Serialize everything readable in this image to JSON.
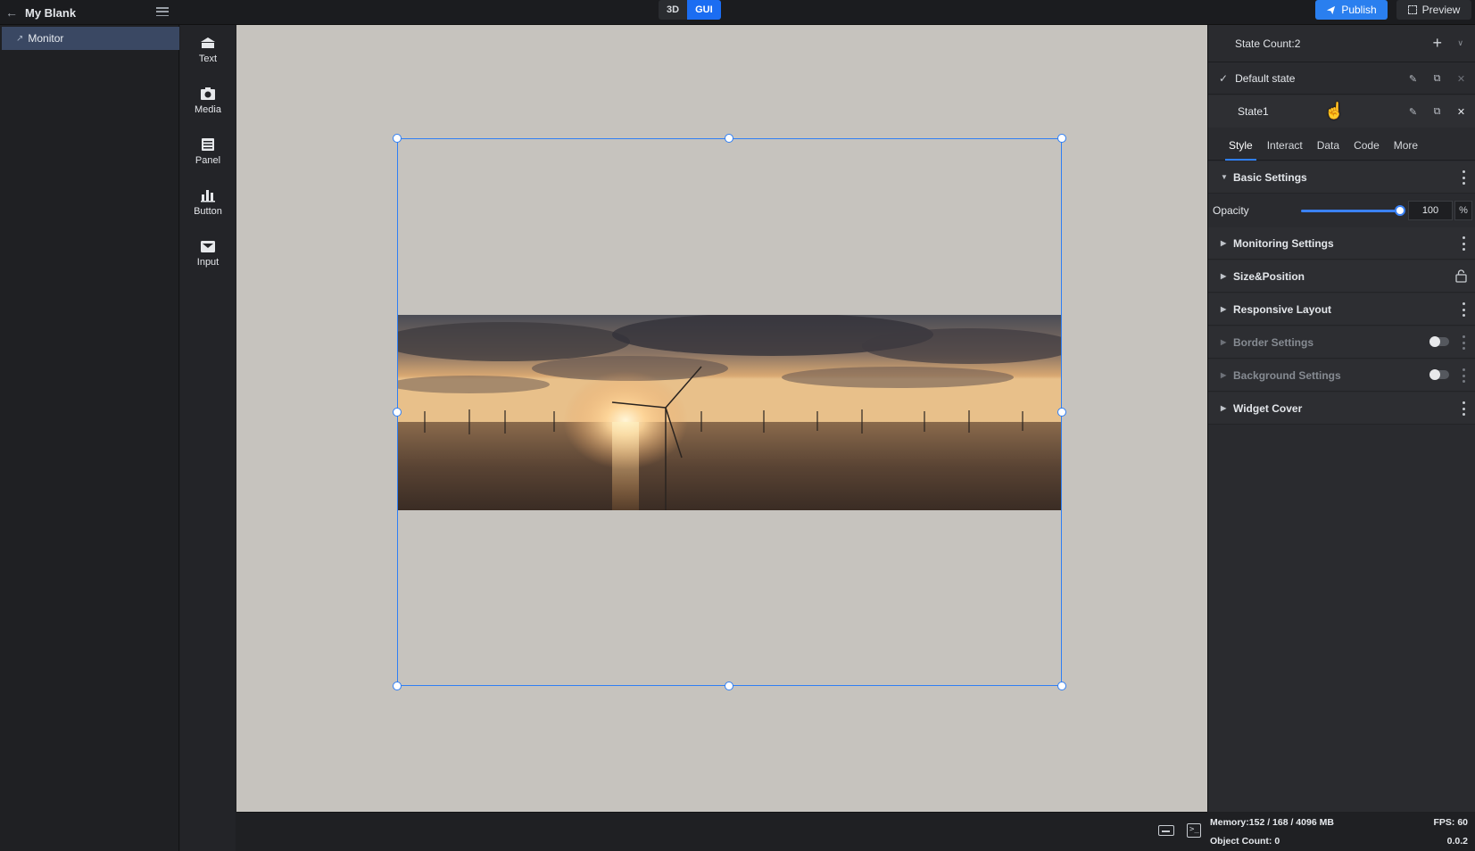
{
  "app": {
    "title": "My Blank"
  },
  "modes": [
    {
      "label": "3D",
      "active": false
    },
    {
      "label": "GUI",
      "active": true
    }
  ],
  "header": {
    "publish_label": "Publish",
    "preview_label": "Preview"
  },
  "layers": {
    "items": [
      {
        "label": "Monitor",
        "selected": true
      }
    ]
  },
  "widgets": [
    {
      "label": "Text",
      "icon": "text-icon"
    },
    {
      "label": "Media",
      "icon": "media-icon"
    },
    {
      "label": "Panel",
      "icon": "panel-icon"
    },
    {
      "label": "Button",
      "icon": "button-icon"
    },
    {
      "label": "Input",
      "icon": "input-icon"
    }
  ],
  "canvas": {
    "background": "#c6c3be",
    "selection_color": "#2f7ff5"
  },
  "props": {
    "state_count": "State Count:2",
    "states": [
      {
        "label": "Default state",
        "checked": true
      },
      {
        "label": "State1",
        "checked": false
      }
    ],
    "tabs": [
      {
        "label": "Style",
        "active": true
      },
      {
        "label": "Interact"
      },
      {
        "label": "Data"
      },
      {
        "label": "Code"
      },
      {
        "label": "More"
      }
    ],
    "sections": [
      {
        "label": "Basic Settings",
        "expanded": true
      },
      {
        "label": "Monitoring Settings"
      },
      {
        "label": "Size&Position"
      },
      {
        "label": "Responsive Layout"
      },
      {
        "label": "Border Settings",
        "disabled": true
      },
      {
        "label": "Background Settings",
        "disabled": true
      },
      {
        "label": "Widget Cover"
      }
    ],
    "opacity": {
      "label": "Opacity",
      "value": "100",
      "unit": "%"
    }
  },
  "status": {
    "memory": "Memory:152 / 168 / 4096 MB",
    "fps": "FPS: 60",
    "object_count": "Object Count: 0",
    "version": "0.0.2"
  }
}
